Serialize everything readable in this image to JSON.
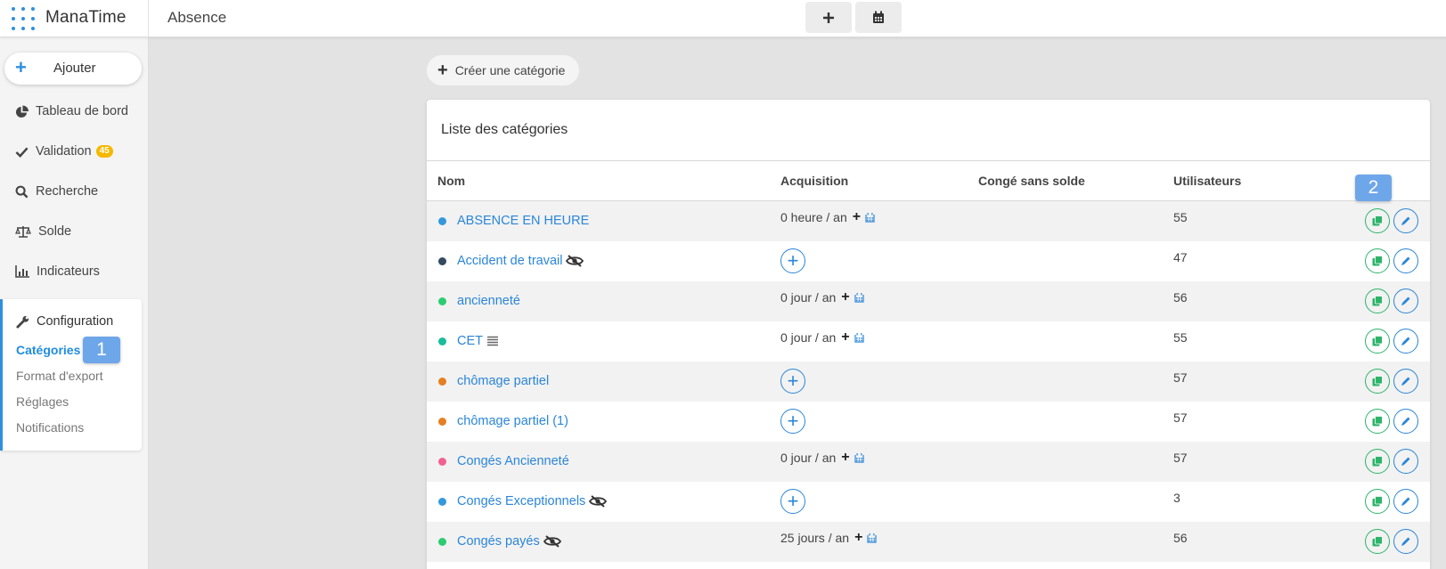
{
  "app": {
    "name": "ManaTime",
    "page_title": "Absence"
  },
  "toolbar": {
    "add_icon": "plus-icon",
    "calendar_icon": "calendar-icon"
  },
  "sidebar": {
    "add_label": "Ajouter",
    "nav": [
      {
        "label": "Tableau de bord",
        "icon": "pie-chart-icon"
      },
      {
        "label": "Validation",
        "icon": "check-icon",
        "badge": "45"
      },
      {
        "label": "Recherche",
        "icon": "search-icon"
      },
      {
        "label": "Solde",
        "icon": "scale-icon"
      },
      {
        "label": "Indicateurs",
        "icon": "bar-chart-icon"
      }
    ],
    "config": {
      "title": "Configuration",
      "items": [
        "Catégories",
        "Format d'export",
        "Réglages",
        "Notifications"
      ],
      "active": "Catégories"
    }
  },
  "callouts": [
    "1",
    "2"
  ],
  "main": {
    "create_label": "Créer une catégorie",
    "card_title": "Liste des catégories",
    "columns": [
      "Nom",
      "Acquisition",
      "Congé sans solde",
      "Utilisateurs"
    ],
    "rows": [
      {
        "name": "ABSENCE EN HEURE",
        "color": "#3498db",
        "acquisition": "0 heure / an",
        "users": "55",
        "hidden": false,
        "list": false
      },
      {
        "name": "Accident de travail",
        "color": "#34495e",
        "acquisition": "",
        "users": "47",
        "hidden": true,
        "list": false
      },
      {
        "name": "ancienneté",
        "color": "#2ecc71",
        "acquisition": "0 jour / an",
        "users": "56",
        "hidden": false,
        "list": false
      },
      {
        "name": "CET",
        "color": "#1abc9c",
        "acquisition": "0 jour / an",
        "users": "55",
        "hidden": false,
        "list": true
      },
      {
        "name": "chômage partiel",
        "color": "#e67e22",
        "acquisition": "",
        "users": "57",
        "hidden": false,
        "list": false
      },
      {
        "name": "chômage partiel (1)",
        "color": "#e67e22",
        "acquisition": "",
        "users": "57",
        "hidden": false,
        "list": false
      },
      {
        "name": "Congés Ancienneté",
        "color": "#f06292",
        "acquisition": "0 jour / an",
        "users": "57",
        "hidden": false,
        "list": false
      },
      {
        "name": "Congés Exceptionnels",
        "color": "#3498db",
        "acquisition": "",
        "users": "3",
        "hidden": true,
        "list": false
      },
      {
        "name": "Congés payés",
        "color": "#2ecc71",
        "acquisition": "25 jours / an",
        "users": "56",
        "hidden": true,
        "list": false
      }
    ]
  },
  "colors": {
    "accent": "#2a86d8",
    "copy": "#2db36a",
    "badge": "#f5b800",
    "callout": "#6ea6ea"
  }
}
